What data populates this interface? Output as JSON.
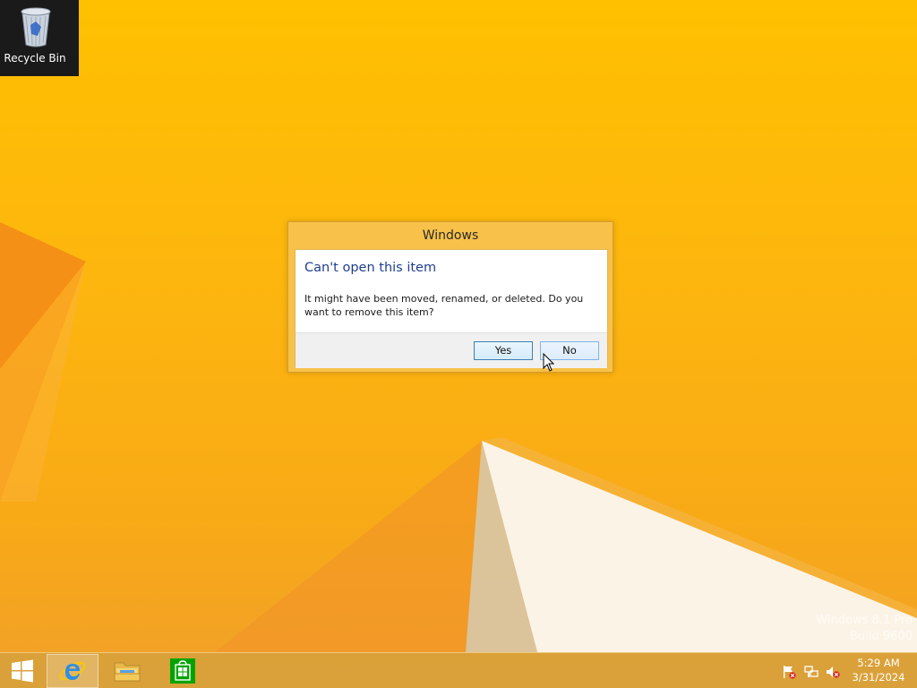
{
  "desktop": {
    "recycle_bin": {
      "label": "Recycle Bin",
      "icon": "recycle-bin-icon"
    },
    "watermark": {
      "line1": "Windows 8.1 Pro",
      "line2": "Build 9600"
    }
  },
  "dialog": {
    "title": "Windows",
    "heading": "Can't open this item",
    "message": "It might have been moved, renamed, or deleted. Do you want to remove this item?",
    "buttons": {
      "yes": "Yes",
      "no": "No"
    }
  },
  "taskbar": {
    "start_icon": "windows-logo-icon",
    "pinned": [
      {
        "name": "Internet Explorer",
        "icon": "internet-explorer-icon",
        "active": true
      },
      {
        "name": "File Explorer",
        "icon": "file-explorer-icon",
        "active": false
      },
      {
        "name": "Store",
        "icon": "store-icon",
        "active": false
      }
    ],
    "tray": {
      "icons": [
        "action-center-flag-icon",
        "network-icon",
        "volume-muted-icon"
      ],
      "time": "5:29 AM",
      "date": "3/31/2024"
    }
  },
  "colors": {
    "wallpaper": "#fdb60e",
    "dialog_frame": "#f7c14a",
    "heading_text": "#1f3f8f",
    "store_green": "#00a300"
  }
}
